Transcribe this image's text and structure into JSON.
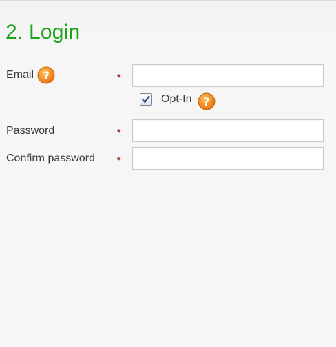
{
  "section": {
    "title": "2. Login"
  },
  "fields": {
    "email": {
      "label": "Email",
      "required_marker": "*",
      "value": ""
    },
    "opt_in": {
      "label": "Opt-In",
      "checked": true
    },
    "password": {
      "label": "Password",
      "required_marker": "*",
      "value": ""
    },
    "confirm_password": {
      "label": "Confirm password",
      "required_marker": "*",
      "value": ""
    }
  },
  "icons": {
    "help": "question-mark-help-icon",
    "check": "checkmark-icon"
  },
  "colors": {
    "title": "#1aa61a",
    "required": "#b22222",
    "help_icon": "#f08a1c"
  }
}
